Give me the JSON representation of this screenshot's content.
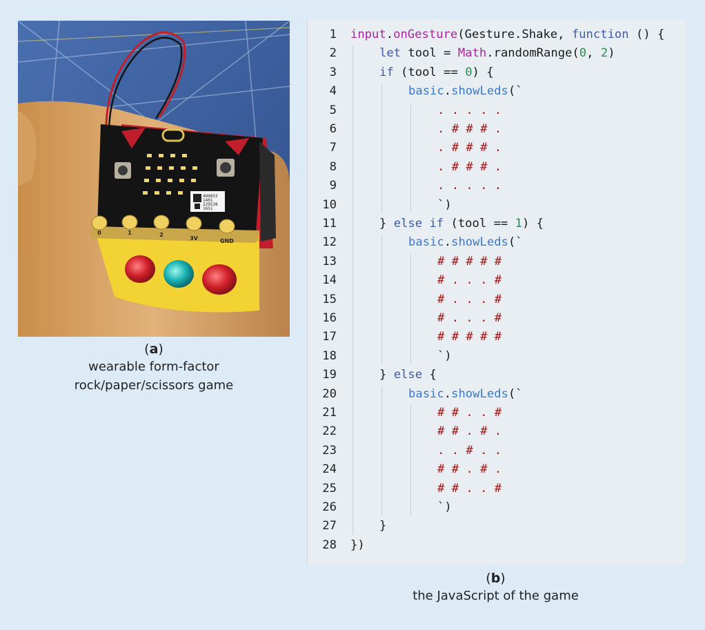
{
  "figure_a": {
    "letter": "a",
    "caption_lines": [
      "wearable form-factor",
      "rock/paper/scissors game"
    ],
    "board_pins": [
      "0",
      "1",
      "2",
      "3V",
      "GND"
    ],
    "sticker_lines": [
      "400853",
      "1401",
      "229528",
      "1651"
    ]
  },
  "figure_b": {
    "letter": "b",
    "caption_lines": [
      "the JavaScript of the game"
    ]
  },
  "colors": {
    "background": "#dcebf5",
    "code_background": "#e9eef2",
    "keyword": "#3d5aa6",
    "magenta": "#a8269a",
    "method": "#3c78c4",
    "number": "#2e8b57",
    "led_pattern": "#a31515"
  },
  "code": {
    "lines": [
      {
        "n": "1",
        "indent": 0,
        "tokens": [
          [
            "input",
            "magenta"
          ],
          [
            ".",
            "plain"
          ],
          [
            "onGesture",
            "magenta"
          ],
          [
            "(Gesture.Shake, ",
            "plain"
          ],
          [
            "function",
            "kw"
          ],
          [
            " () {",
            "plain"
          ]
        ]
      },
      {
        "n": "2",
        "indent": 1,
        "tokens": [
          [
            "let",
            "kw"
          ],
          [
            " tool = ",
            "plain"
          ],
          [
            "Math",
            "magenta"
          ],
          [
            ".randomRange(",
            "plain"
          ],
          [
            "0",
            "num"
          ],
          [
            ", ",
            "plain"
          ],
          [
            "2",
            "num"
          ],
          [
            ")",
            "plain"
          ]
        ]
      },
      {
        "n": "3",
        "indent": 1,
        "tokens": [
          [
            "if",
            "kw"
          ],
          [
            " (tool == ",
            "plain"
          ],
          [
            "0",
            "num"
          ],
          [
            ") {",
            "plain"
          ]
        ]
      },
      {
        "n": "4",
        "indent": 2,
        "tokens": [
          [
            "basic",
            "method"
          ],
          [
            ".",
            "plain"
          ],
          [
            "showLeds",
            "method"
          ],
          [
            "(`",
            "plain"
          ]
        ]
      },
      {
        "n": "5",
        "indent": 3,
        "tokens": [
          [
            ". . . . .",
            "led"
          ]
        ]
      },
      {
        "n": "6",
        "indent": 3,
        "tokens": [
          [
            ". # # # .",
            "led"
          ]
        ]
      },
      {
        "n": "7",
        "indent": 3,
        "tokens": [
          [
            ". # # # .",
            "led"
          ]
        ]
      },
      {
        "n": "8",
        "indent": 3,
        "tokens": [
          [
            ". # # # .",
            "led"
          ]
        ]
      },
      {
        "n": "9",
        "indent": 3,
        "tokens": [
          [
            ". . . . .",
            "led"
          ]
        ]
      },
      {
        "n": "10",
        "indent": 3,
        "tokens": [
          [
            "`)",
            "plain"
          ]
        ]
      },
      {
        "n": "11",
        "indent": 1,
        "tokens": [
          [
            "} ",
            "plain"
          ],
          [
            "else if",
            "kw"
          ],
          [
            " (tool == ",
            "plain"
          ],
          [
            "1",
            "num"
          ],
          [
            ") {",
            "plain"
          ]
        ]
      },
      {
        "n": "12",
        "indent": 2,
        "tokens": [
          [
            "basic",
            "method"
          ],
          [
            ".",
            "plain"
          ],
          [
            "showLeds",
            "method"
          ],
          [
            "(`",
            "plain"
          ]
        ]
      },
      {
        "n": "13",
        "indent": 3,
        "tokens": [
          [
            "# # # # #",
            "led"
          ]
        ]
      },
      {
        "n": "14",
        "indent": 3,
        "tokens": [
          [
            "# . . . #",
            "led"
          ]
        ]
      },
      {
        "n": "15",
        "indent": 3,
        "tokens": [
          [
            "# . . . #",
            "led"
          ]
        ]
      },
      {
        "n": "16",
        "indent": 3,
        "tokens": [
          [
            "# . . . #",
            "led"
          ]
        ]
      },
      {
        "n": "17",
        "indent": 3,
        "tokens": [
          [
            "# # # # #",
            "led"
          ]
        ]
      },
      {
        "n": "18",
        "indent": 3,
        "tokens": [
          [
            "`)",
            "plain"
          ]
        ]
      },
      {
        "n": "19",
        "indent": 1,
        "tokens": [
          [
            "} ",
            "plain"
          ],
          [
            "else",
            "kw"
          ],
          [
            " {",
            "plain"
          ]
        ]
      },
      {
        "n": "20",
        "indent": 2,
        "tokens": [
          [
            "basic",
            "method"
          ],
          [
            ".",
            "plain"
          ],
          [
            "showLeds",
            "method"
          ],
          [
            "(`",
            "plain"
          ]
        ]
      },
      {
        "n": "21",
        "indent": 3,
        "tokens": [
          [
            "# # . . #",
            "led"
          ]
        ]
      },
      {
        "n": "22",
        "indent": 3,
        "tokens": [
          [
            "# # . # .",
            "led"
          ]
        ]
      },
      {
        "n": "23",
        "indent": 3,
        "tokens": [
          [
            ". . # . .",
            "led"
          ]
        ]
      },
      {
        "n": "24",
        "indent": 3,
        "tokens": [
          [
            "# # . # .",
            "led"
          ]
        ]
      },
      {
        "n": "25",
        "indent": 3,
        "tokens": [
          [
            "# # . . #",
            "led"
          ]
        ]
      },
      {
        "n": "26",
        "indent": 3,
        "tokens": [
          [
            "`)",
            "plain"
          ]
        ]
      },
      {
        "n": "27",
        "indent": 1,
        "tokens": [
          [
            "}",
            "plain"
          ]
        ]
      },
      {
        "n": "28",
        "indent": 0,
        "tokens": [
          [
            "})",
            "plain"
          ]
        ]
      }
    ]
  }
}
